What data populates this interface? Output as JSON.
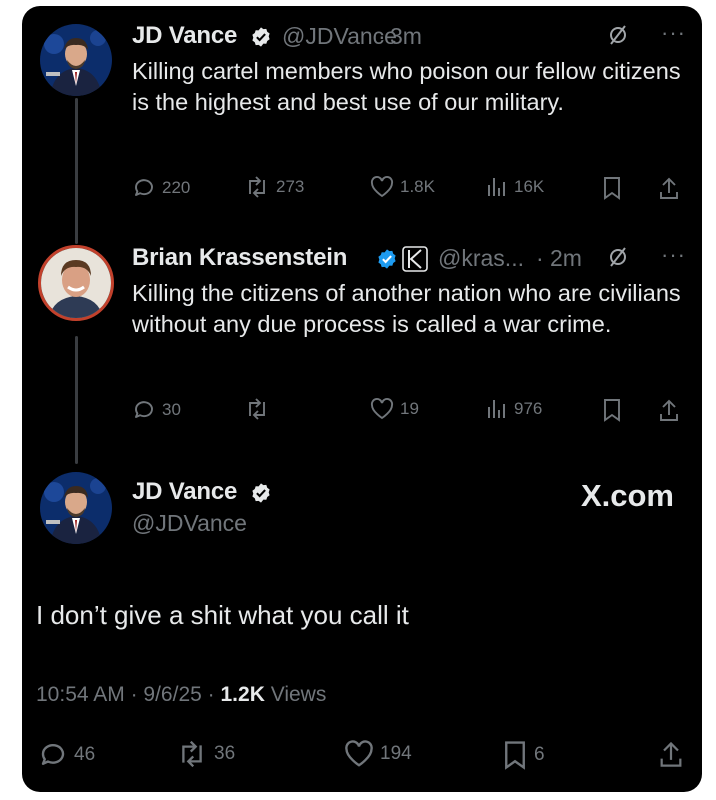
{
  "tweets": [
    {
      "name": "JD Vance",
      "handle": "@JDVance",
      "time": "3m",
      "text": "Killing cartel members who poison our fellow citizens is the highest and best use of our military.",
      "stats": {
        "replies": "220",
        "reposts": "273",
        "likes": "1.8K",
        "views": "16K"
      }
    },
    {
      "name": "Brian Krassenstein",
      "handle": "@kras...",
      "time": "2m",
      "text": "Killing the citizens of another nation who are civilians without any due process is called a war crime.",
      "stats": {
        "replies": "30",
        "reposts": "",
        "likes": "19",
        "views": "976"
      }
    }
  ],
  "main_tweet": {
    "name": "JD Vance",
    "handle": "@JDVance",
    "text": "I don’t give a shit what you call it",
    "time": "10:54 AM",
    "date": "9/6/25",
    "views_count": "1.2K",
    "views_label": "Views",
    "stats": {
      "replies": "46",
      "reposts": "36",
      "likes": "194",
      "bookmarks": "6"
    }
  },
  "brand": {
    "x_logo_text": "X.com"
  },
  "separators": {
    "dot": "·"
  },
  "icons": {
    "verified": "verified-badge-icon",
    "grok": "grok-icon",
    "more": "more-icon",
    "reply": "reply-icon",
    "repost": "repost-icon",
    "like": "like-icon",
    "views": "views-icon",
    "bookmark": "bookmark-icon",
    "share": "share-icon",
    "affiliate": "affiliate-k-icon"
  },
  "colors": {
    "background": "#000000",
    "text": "#e7e9ea",
    "muted": "#71767b",
    "verified": "#1d9bf0",
    "thread_line": "#3a3d41"
  }
}
